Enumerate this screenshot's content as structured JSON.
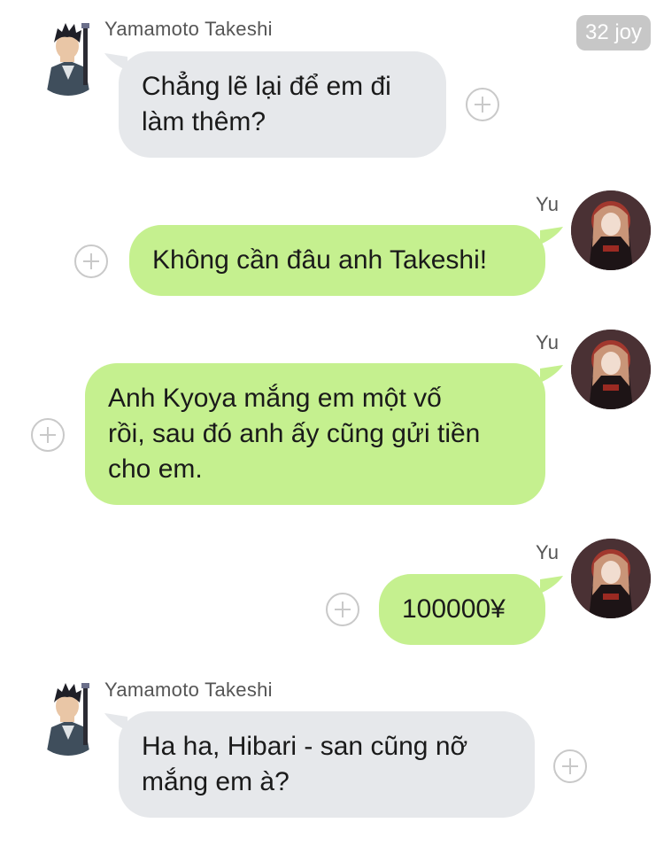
{
  "badge": {
    "time": "32 joy"
  },
  "messages": [
    {
      "side": "in",
      "sender": "Yamamoto Takeshi",
      "text": "Chẳng lẽ lại để em đi\nlàm thêm?"
    },
    {
      "side": "out",
      "sender": "Yu",
      "text": "Không cần đâu anh Takeshi!"
    },
    {
      "side": "out",
      "sender": "Yu",
      "text": "Anh Kyoya mắng em một vố\nrồi, sau đó anh ấy cũng gửi tiền\ncho em."
    },
    {
      "side": "out",
      "sender": "Yu",
      "text": "100000¥"
    },
    {
      "side": "in",
      "sender": "Yamamoto Takeshi",
      "text": "Ha ha, Hibari - san cũng nỡ\nmắng em à?"
    }
  ],
  "icons": {
    "add": "plus-circle-icon",
    "avatar_takeshi": "avatar-takeshi",
    "avatar_yu": "avatar-yu"
  },
  "colors": {
    "incoming_bubble": "#e6e8eb",
    "outgoing_bubble": "#c5f08f",
    "time_badge": "#c7c7c7"
  }
}
